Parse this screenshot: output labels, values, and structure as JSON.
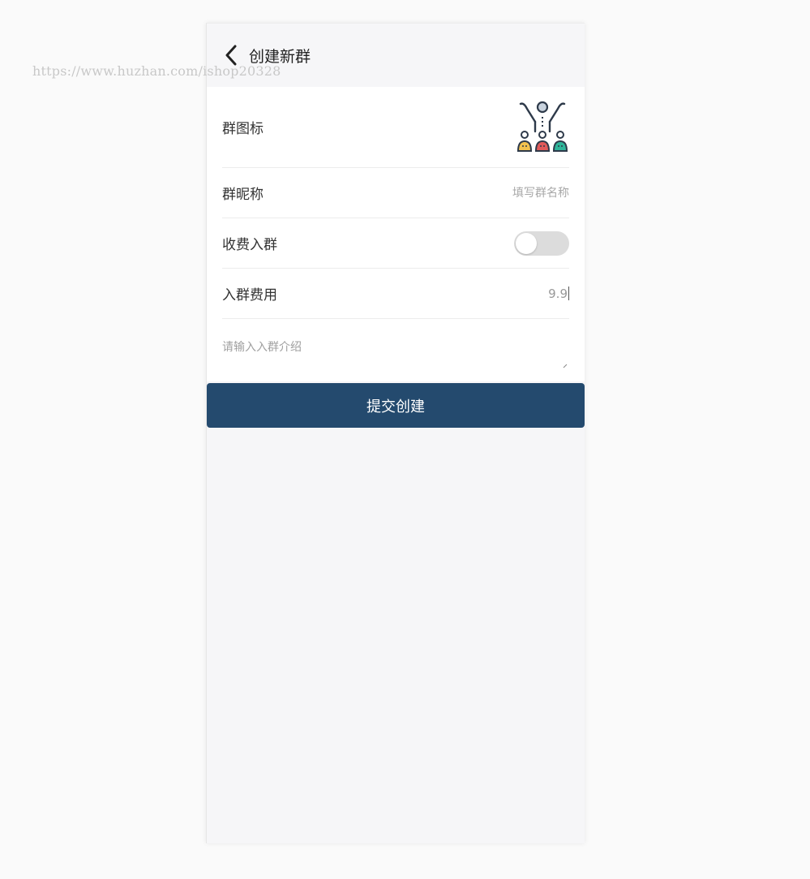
{
  "watermark": "https://www.huzhan.com/ishop20328",
  "header": {
    "title": "创建新群"
  },
  "form": {
    "icon_label": "群图标",
    "name_label": "群昵称",
    "name_placeholder": "填写群名称",
    "paid_label": "收费入群",
    "paid_enabled": false,
    "fee_label": "入群费用",
    "fee_value": "9.9",
    "intro_placeholder": "请输入入群介绍"
  },
  "submit_label": "提交创建",
  "colors": {
    "accent": "#244a6e",
    "toggle_off": "#dcdcdc",
    "person_yellow": "#f2c14e",
    "person_red": "#e05a5a",
    "person_teal": "#2fb59a",
    "icon_stroke": "#2e3a4a"
  }
}
